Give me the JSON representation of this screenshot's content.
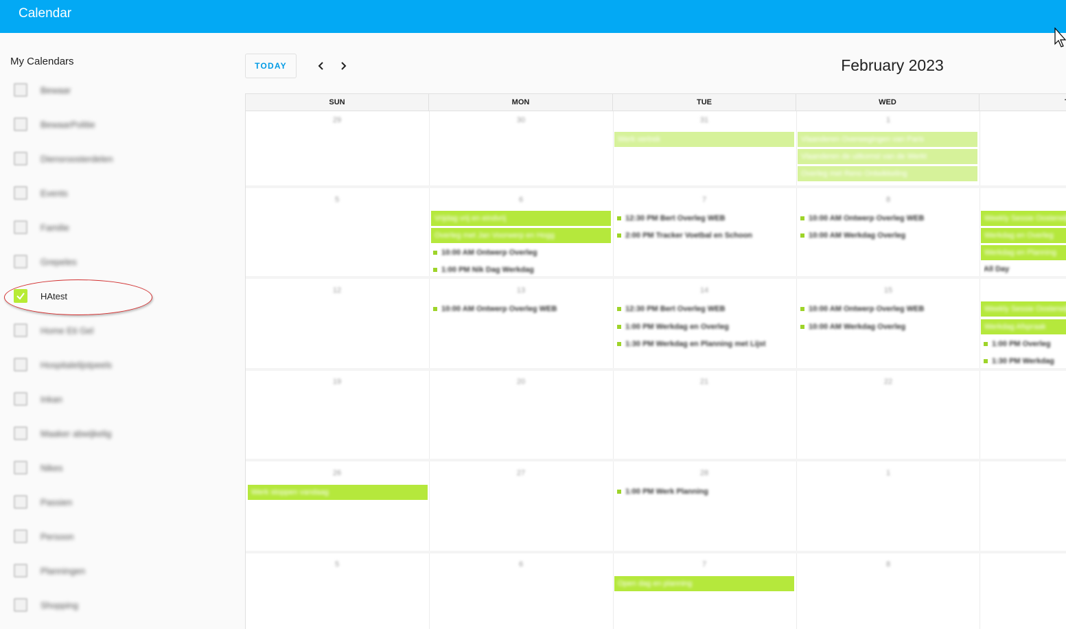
{
  "app": {
    "title": "Calendar"
  },
  "sidebar": {
    "heading": "My Calendars",
    "items": [
      {
        "label": "Bewaar",
        "checked": false
      },
      {
        "label": "BewaarPolitie",
        "checked": false
      },
      {
        "label": "Diensroosterdelen",
        "checked": false
      },
      {
        "label": "Events",
        "checked": false
      },
      {
        "label": "Familie",
        "checked": false
      },
      {
        "label": "Grepeles",
        "checked": false
      },
      {
        "label": "HAtest",
        "checked": true
      },
      {
        "label": "Home Eti Gel",
        "checked": false
      },
      {
        "label": "Hospitalelijstpeels",
        "checked": false
      },
      {
        "label": "Inkan",
        "checked": false
      },
      {
        "label": "Maaker abwijkelig",
        "checked": false
      },
      {
        "label": "Nikes",
        "checked": false
      },
      {
        "label": "Passien",
        "checked": false
      },
      {
        "label": "Persoon",
        "checked": false
      },
      {
        "label": "Planningen",
        "checked": false
      },
      {
        "label": "Shopping",
        "checked": false
      }
    ]
  },
  "toolbar": {
    "today_label": "TODAY",
    "prev_icon": "chevron-left-icon",
    "next_icon": "chevron-right-icon",
    "month_title": "February 2023"
  },
  "calendar": {
    "days_of_week": [
      "SUN",
      "MON",
      "TUE",
      "WED",
      "T"
    ],
    "weeks": [
      {
        "days": [
          "29",
          "30",
          "31",
          "1",
          ""
        ]
      },
      {
        "days": [
          "5",
          "6",
          "7",
          "8",
          ""
        ]
      },
      {
        "days": [
          "12",
          "13",
          "14",
          "15",
          ""
        ]
      },
      {
        "days": [
          "19",
          "20",
          "21",
          "22",
          ""
        ]
      },
      {
        "days": [
          "26",
          "27",
          "28",
          "1",
          ""
        ]
      },
      {
        "days": [
          "5",
          "6",
          "7",
          "8",
          ""
        ]
      }
    ],
    "events": {
      "w0_tue_1": "Werk vertrek",
      "w0_wed_1": "Vlaanderen Overwegingen van Paris",
      "w0_wed_2": "Vlaanderen de uitkomst van de Werkt",
      "w0_wed_3": "Overleg met Reno Ontwikkeling",
      "w1_mon_1": "Vrijdag vrij en eindvrij",
      "w1_mon_2": "Overleg met Jan Voorwerp en Hogg",
      "w1_mon_3": "10:00 AM Ontwerp Overleg",
      "w1_mon_4": "1:00 PM Nik Dag Werkdag",
      "w1_tue_1": "12:30 PM Bert Overleg WEB",
      "w1_tue_2": "2:00 PM Tracker Voetbal en Schoon",
      "w1_wed_1": "10:00 AM Ontwerp Overleg WEB",
      "w1_wed_2": "10:00 AM Werkdag Overleg",
      "w1_thu_1": "Weekly Sessie Oosterwijk",
      "w1_thu_2": "Werkdag en Overleg",
      "w1_thu_3": "Werkdag en Planning",
      "w1_thu_4": "All Day",
      "w2_mon_1": "10:00 AM Ontwerp Overleg WEB",
      "w2_tue_1": "12:30 PM Bert Overleg WEB",
      "w2_tue_2": "1:00 PM Werkdag en Overleg",
      "w2_tue_3": "1:30 PM Werkdag en Planning met Lijst",
      "w2_wed_1": "10:00 AM Ontwerp Overleg WEB",
      "w2_wed_2": "10:00 AM Werkdag Overleg",
      "w2_thu_1": "Weekly Sessie Oosterwijk",
      "w2_thu_2": "Werkdag Afspraak",
      "w2_thu_3": "1:00 PM Overleg",
      "w2_thu_4": "1:30 PM Werkdag",
      "w4_sun_1": "Werk stoppen vandaag",
      "w4_tue_1": "1:00 PM Werk Planning",
      "w5_tue_1": "Open dag en planning"
    }
  },
  "colors": {
    "accent": "#03a9f4",
    "event": "#b5e83c",
    "event_light": "#d6f29a",
    "today_text": "#039be5",
    "annotation": "#d32f2f"
  }
}
